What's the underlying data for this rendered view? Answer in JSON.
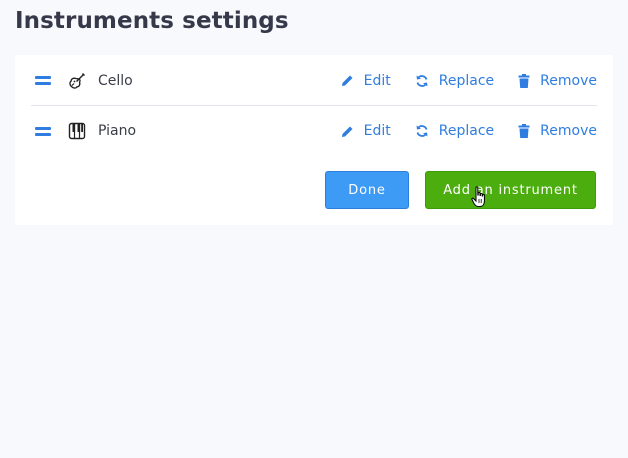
{
  "page": {
    "title": "Instruments settings"
  },
  "instruments": [
    {
      "name": "Cello",
      "icon": "cello-icon"
    },
    {
      "name": "Piano",
      "icon": "piano-icon"
    }
  ],
  "actions": {
    "edit_label": "Edit",
    "replace_label": "Replace",
    "remove_label": "Remove"
  },
  "buttons": {
    "done_label": "Done",
    "add_label": "Add an instrument"
  },
  "colors": {
    "link": "#2f7de1",
    "done": "#3d9af5",
    "add": "#4cae0e",
    "background": "#f8f9fc"
  }
}
